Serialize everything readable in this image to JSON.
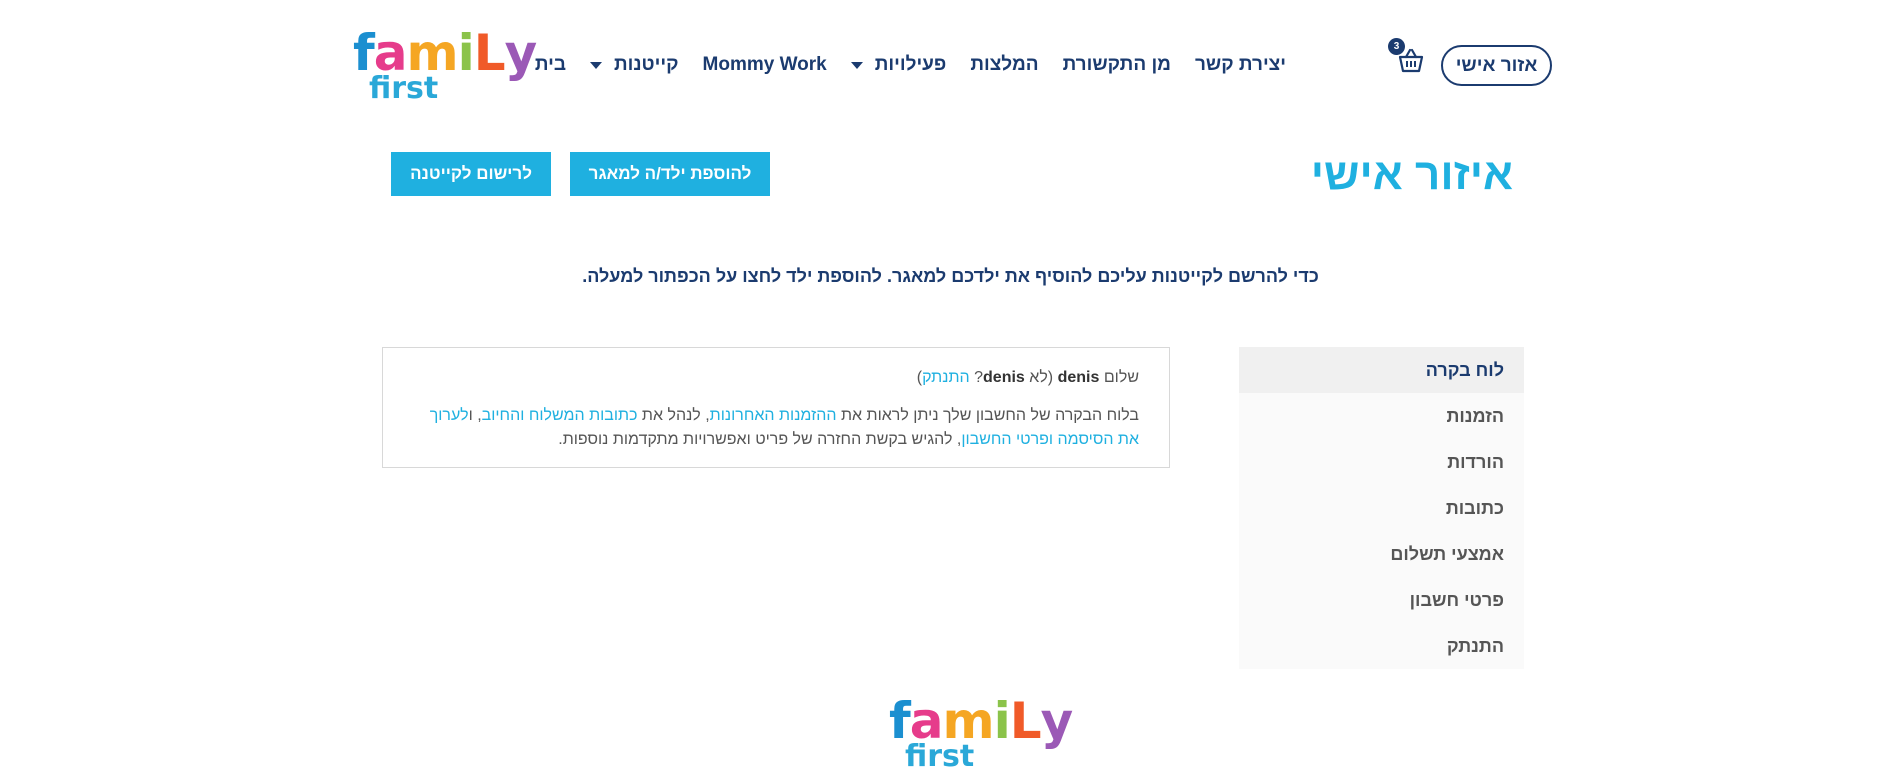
{
  "brand": {
    "logo_top": [
      "f",
      "a",
      "m",
      "i",
      "L",
      "y"
    ],
    "logo_top_colors": [
      "#1b8fd0",
      "#e63c8b",
      "#f5a623",
      "#8bc34a",
      "#f05a28",
      "#9b59b6"
    ],
    "logo_bottom": "first"
  },
  "header": {
    "nav": [
      {
        "label": "בית",
        "dropdown": false
      },
      {
        "label": "קייטנות",
        "dropdown": true
      },
      {
        "label": "Mommy Work",
        "dropdown": false
      },
      {
        "label": "פעילויות",
        "dropdown": true
      },
      {
        "label": "המלצות",
        "dropdown": false
      },
      {
        "label": "מן התקשורת",
        "dropdown": false
      },
      {
        "label": "יצירת קשר",
        "dropdown": false
      }
    ],
    "cart_count": "3",
    "account_button": "אזור אישי"
  },
  "page": {
    "title": "איזור אישי",
    "add_child_button": "להוספת ילד/ה למאגר",
    "register_button": "לרישום לקייטנה",
    "notice": "כדי להרשם לקייטנות עליכם להוסיף את ילדכם למאגר. להוספת ילד לחצו על הכפתור למעלה."
  },
  "sidebar": {
    "items": [
      {
        "label": "לוח בקרה",
        "active": true
      },
      {
        "label": "הזמנות",
        "active": false
      },
      {
        "label": "הורדות",
        "active": false
      },
      {
        "label": "כתובות",
        "active": false
      },
      {
        "label": "אמצעי תשלום",
        "active": false
      },
      {
        "label": "פרטי חשבון",
        "active": false
      },
      {
        "label": "התנתק",
        "active": false
      }
    ]
  },
  "dashboard": {
    "greeting_prefix": "שלום",
    "username": "denis",
    "not_prefix": "(לא",
    "username2": "denis",
    "question": "?",
    "logout_link": "התנתק",
    "close_paren": ")",
    "text1": "בלוח הבקרה של החשבון שלך ניתן לראות את ",
    "link_orders": "ההזמנות האחרונות",
    "text2": ", לנהל את ",
    "link_addresses": "כתובות המשלוח והחיוב",
    "text3": ", ו",
    "link_password": "לערוך את הסיסמה",
    "text4": " ",
    "link_account": "ופרטי החשבון",
    "text5": ", להגיש בקשת החזרה של פריט ואפשרויות מתקדמות נוספות."
  },
  "colors": {
    "primary": "#1b3b6f",
    "accent": "#1fb0e0"
  }
}
